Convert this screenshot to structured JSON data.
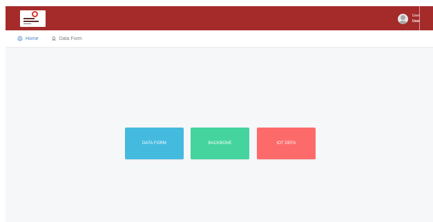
{
  "header": {
    "logo_icon": "company-logo",
    "user": {
      "name": "User",
      "role": "User",
      "avatar_icon": "user-avatar-icon"
    }
  },
  "nav": {
    "items": [
      {
        "label": "Home",
        "icon": "home-icon",
        "active": true
      },
      {
        "label": "Data Form",
        "icon": "data-form-icon",
        "active": false
      }
    ]
  },
  "main": {
    "cards": [
      {
        "label": "DATA FORM",
        "color": "#44badf"
      },
      {
        "label": "BACKBONE",
        "color": "#45d49e"
      },
      {
        "label": "IOT DEFA",
        "color": "#fd6a6a"
      }
    ]
  },
  "colors": {
    "topbar": "#a52a2a",
    "page_background": "#f6f7f9",
    "nav_active": "#4b84c8",
    "nav_inactive": "#7b7b7b"
  }
}
